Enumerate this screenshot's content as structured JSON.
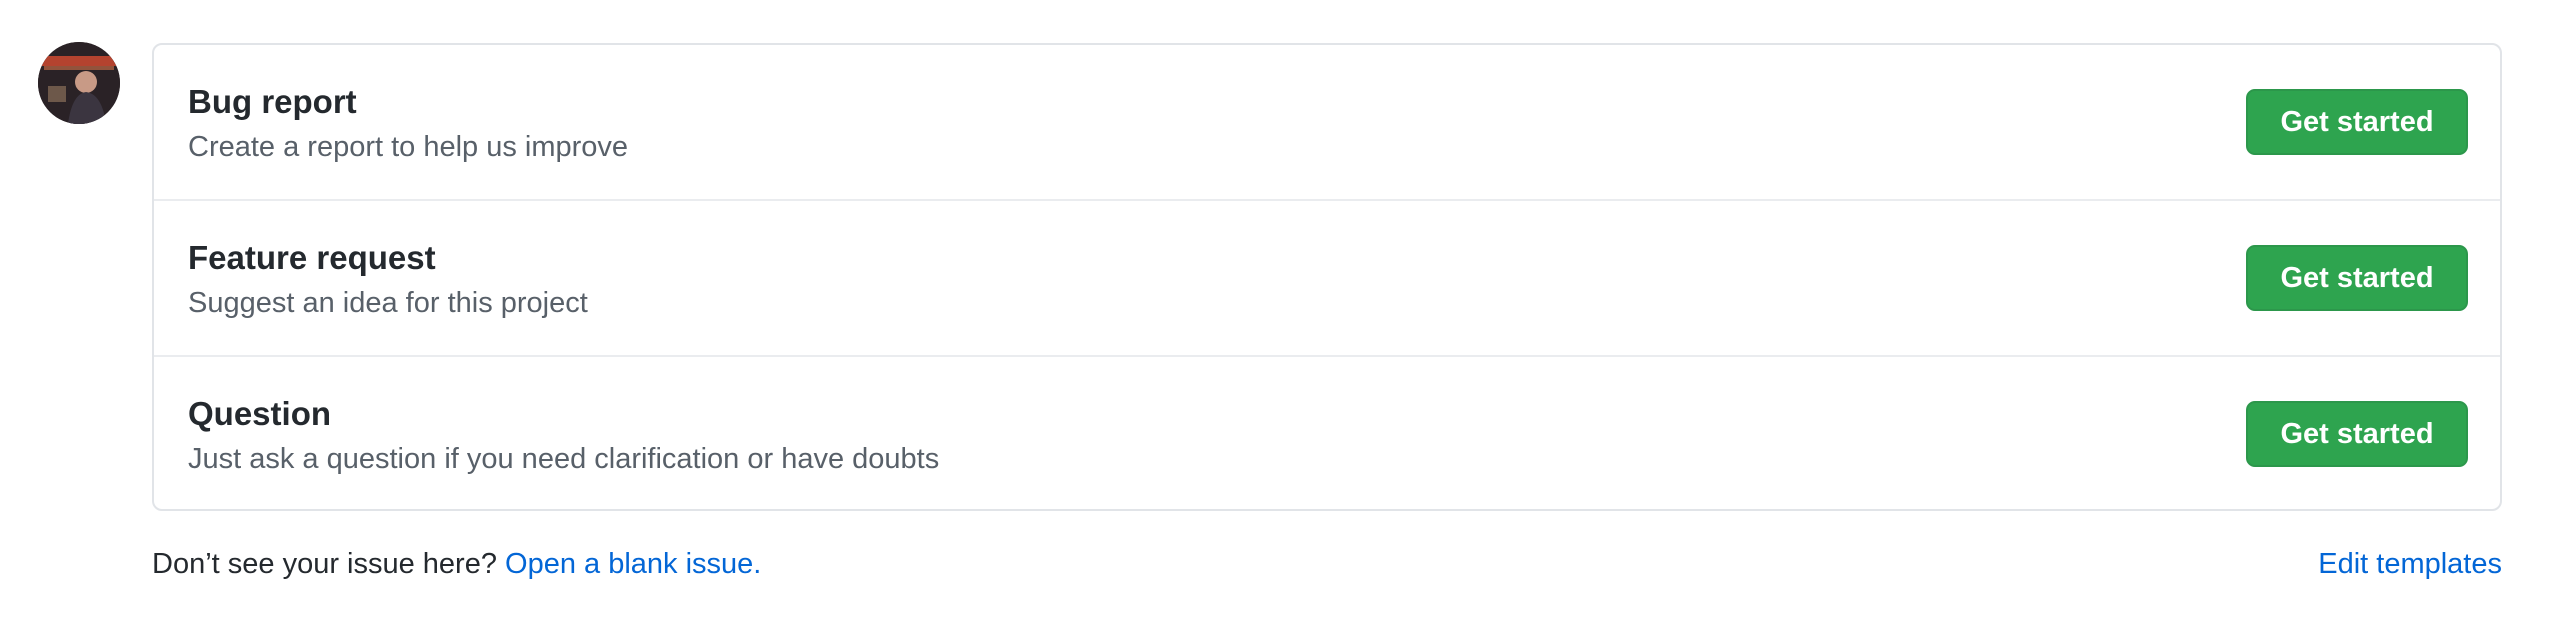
{
  "templates": [
    {
      "title": "Bug report",
      "description": "Create a report to help us improve",
      "button_label": "Get started"
    },
    {
      "title": "Feature request",
      "description": "Suggest an idea for this project",
      "button_label": "Get started"
    },
    {
      "title": "Question",
      "description": "Just ask a question if you need clarification or have doubts",
      "button_label": "Get started"
    }
  ],
  "footer": {
    "prompt": "Don’t see your issue here?",
    "blank_issue_link": "Open a blank issue.",
    "edit_templates_link": "Edit templates"
  },
  "colors": {
    "primary_button": "#2ea44f",
    "link": "#0366d6",
    "muted_text": "#586069",
    "border": "#e1e4e8"
  }
}
